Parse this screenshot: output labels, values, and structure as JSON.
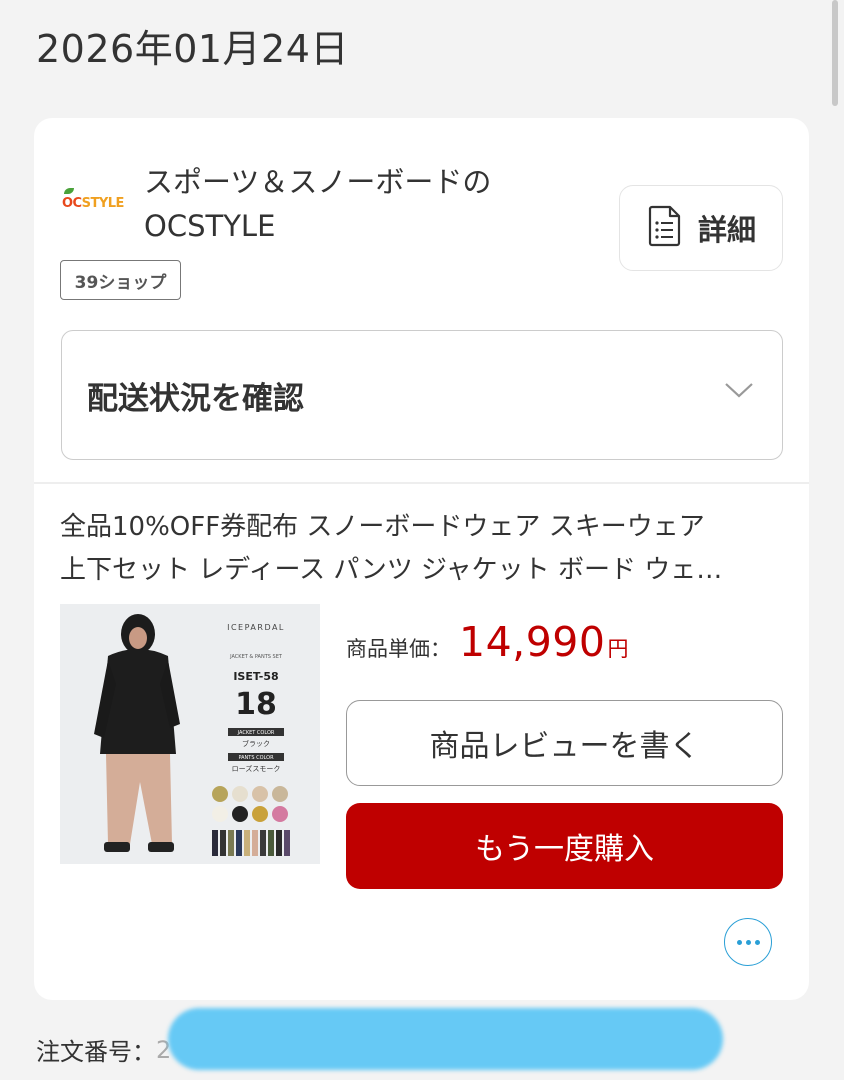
{
  "date": "2026年01月24日",
  "shop": {
    "logo_text_oc": "OC",
    "logo_text_style": "STYLE",
    "name_line1": "スポーツ＆スノーボードの",
    "name_line2": "OCSTYLE",
    "badge": "39ショップ",
    "detail_label": "詳細"
  },
  "shipping": {
    "label": "配送状況を確認"
  },
  "product": {
    "title_line1": "全品10%OFF券配布 スノーボードウェア スキーウェア",
    "title_line2": "上下セット レディース パンツ ジャケット ボード ウェ…",
    "image_text": {
      "brand": "ICEPARDAL",
      "subtitle": "JACKET & PANTS SET",
      "code": "ISET-58",
      "number": "18",
      "jacket_color_label": "JACKET COLOR",
      "jacket_color": "ブラック",
      "pants_color_label": "PANTS COLOR",
      "pants_color": "ローズスモーク"
    },
    "price_label": "商品単価：",
    "price_value": "14,990",
    "price_unit": "円",
    "review_button": "商品レビューを書く",
    "buy_again_button": "もう一度購入"
  },
  "order": {
    "label": "注文番号：",
    "number_visible": "2"
  },
  "colors": {
    "accent_red": "#bf0000",
    "link_blue": "#2a9fd6",
    "redaction": "#66c9f5"
  }
}
